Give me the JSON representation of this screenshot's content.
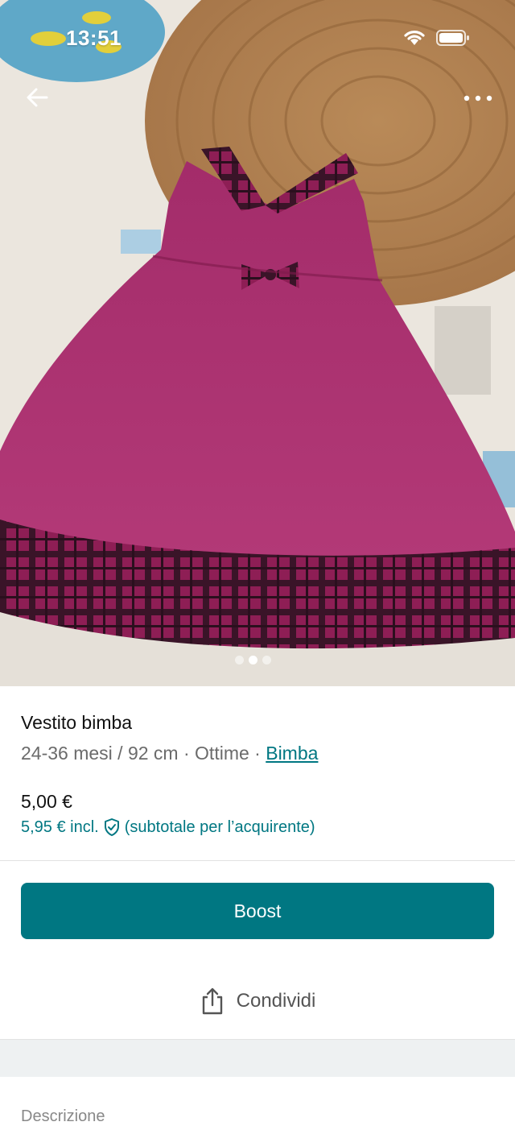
{
  "status_bar": {
    "time": "13:51",
    "icons": [
      "wifi-icon",
      "battery-icon"
    ]
  },
  "top_nav": {
    "back_icon": "arrow-left-icon",
    "more_icon": "more-horizontal-icon"
  },
  "gallery": {
    "image_description": "product-photo",
    "page_count": 3,
    "current_page": 2
  },
  "item": {
    "title": "Vestito bimba",
    "size": "24-36 mesi / 92 cm",
    "separator": " · ",
    "condition": "Ottime",
    "category": "Bimba",
    "price": "5,00 €",
    "price_incl": "5,95 € incl.",
    "price_incl_note": "(subtotale per l’acquirente)"
  },
  "actions": {
    "boost_label": "Boost",
    "share_label": "Condividi"
  },
  "sections": {
    "description_label": "Descrizione"
  },
  "colors": {
    "accent": "#007782",
    "muted_text": "#6b6b6b",
    "band": "#eef1f2"
  }
}
